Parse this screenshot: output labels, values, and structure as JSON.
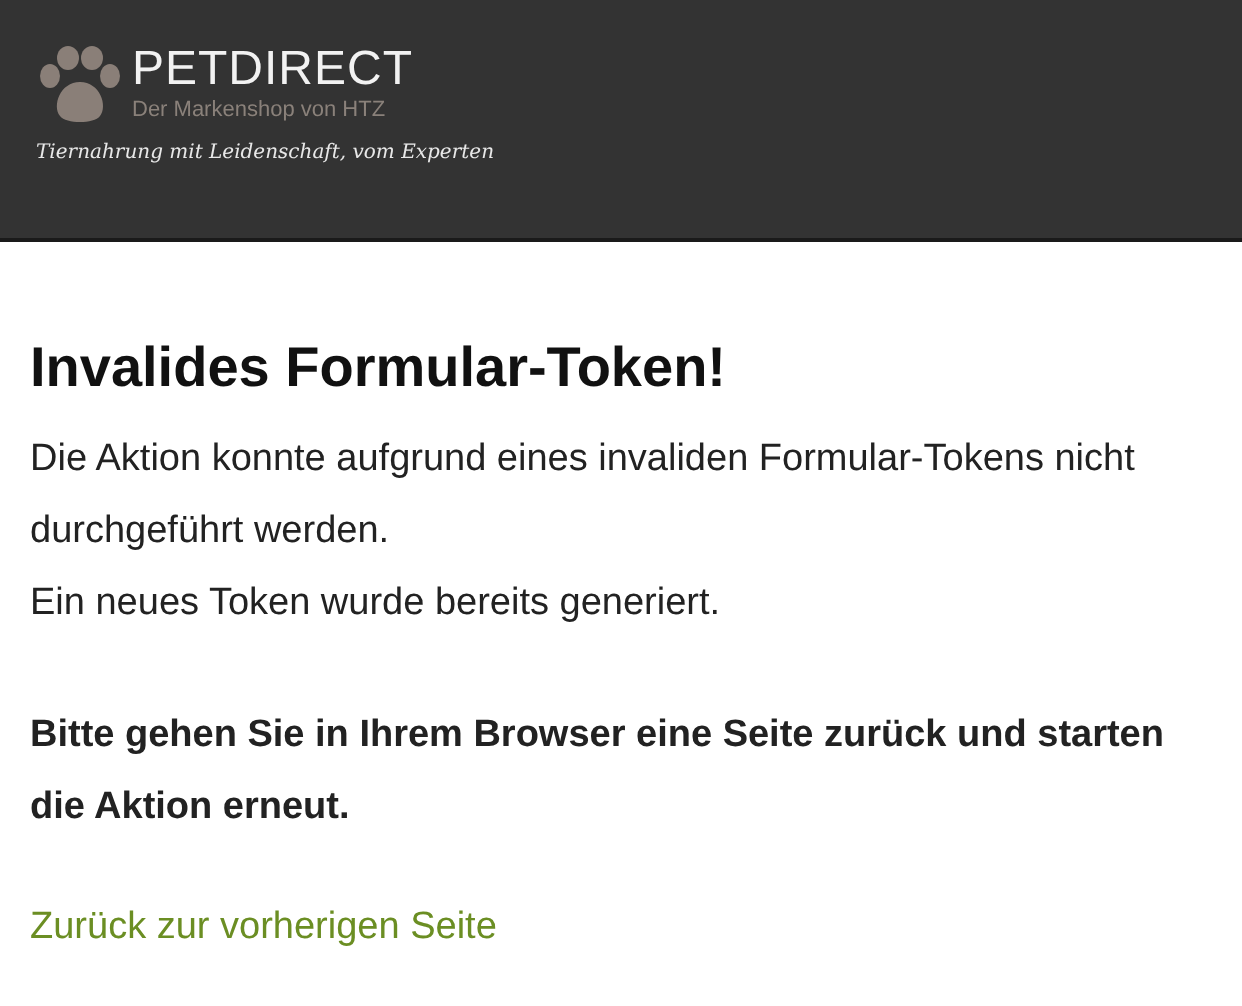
{
  "header": {
    "brand": "PETDIRECT",
    "subtitle": "Der Markenshop von HTZ",
    "slogan": "Tiernahrung mit Leidenschaft, vom Experten"
  },
  "heading": "Invalides Formular-Token!",
  "paragraphs": [
    "Die Aktion konnte aufgrund eines invaliden Formular-Tokens nicht durchgeführt werden.",
    "Ein neues Token wurde bereits generiert."
  ],
  "notice": "Bitte gehen Sie in Ihrem Browser eine Seite zurück und starten die Aktion erneut.",
  "back_link": "Zurück zur vorherigen Seite"
}
